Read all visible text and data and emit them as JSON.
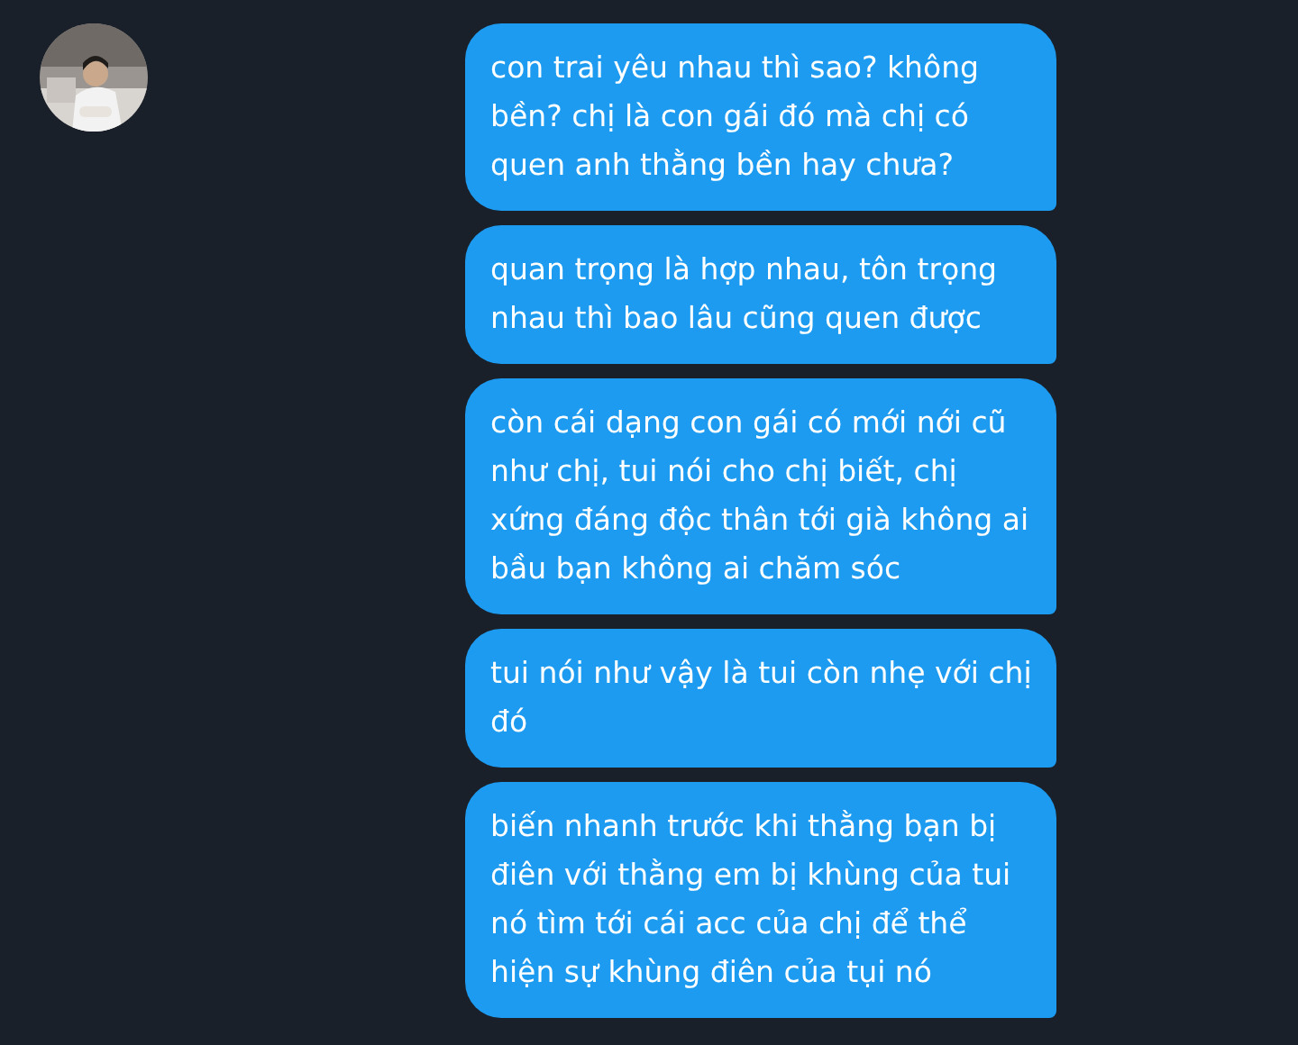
{
  "messages": [
    {
      "text": "con trai yêu nhau thì sao? không bền? chị là con gái đó mà chị có quen anh thằng bền hay chưa?"
    },
    {
      "text": "quan trọng là hợp nhau, tôn trọng nhau thì bao lâu cũng quen được"
    },
    {
      "text": "còn cái dạng con gái có mới nới cũ như chị, tui nói cho chị biết, chị xứng đáng độc thân tới già không ai bầu bạn không ai chăm sóc"
    },
    {
      "text": "tui nói như vậy là tui còn nhẹ với chị đó"
    },
    {
      "text": "biến nhanh trước khi thằng bạn bị điên với thằng em bị khùng của tui nó tìm tới cái acc của chị để thể hiện sự khùng điên của tụi nó"
    }
  ]
}
